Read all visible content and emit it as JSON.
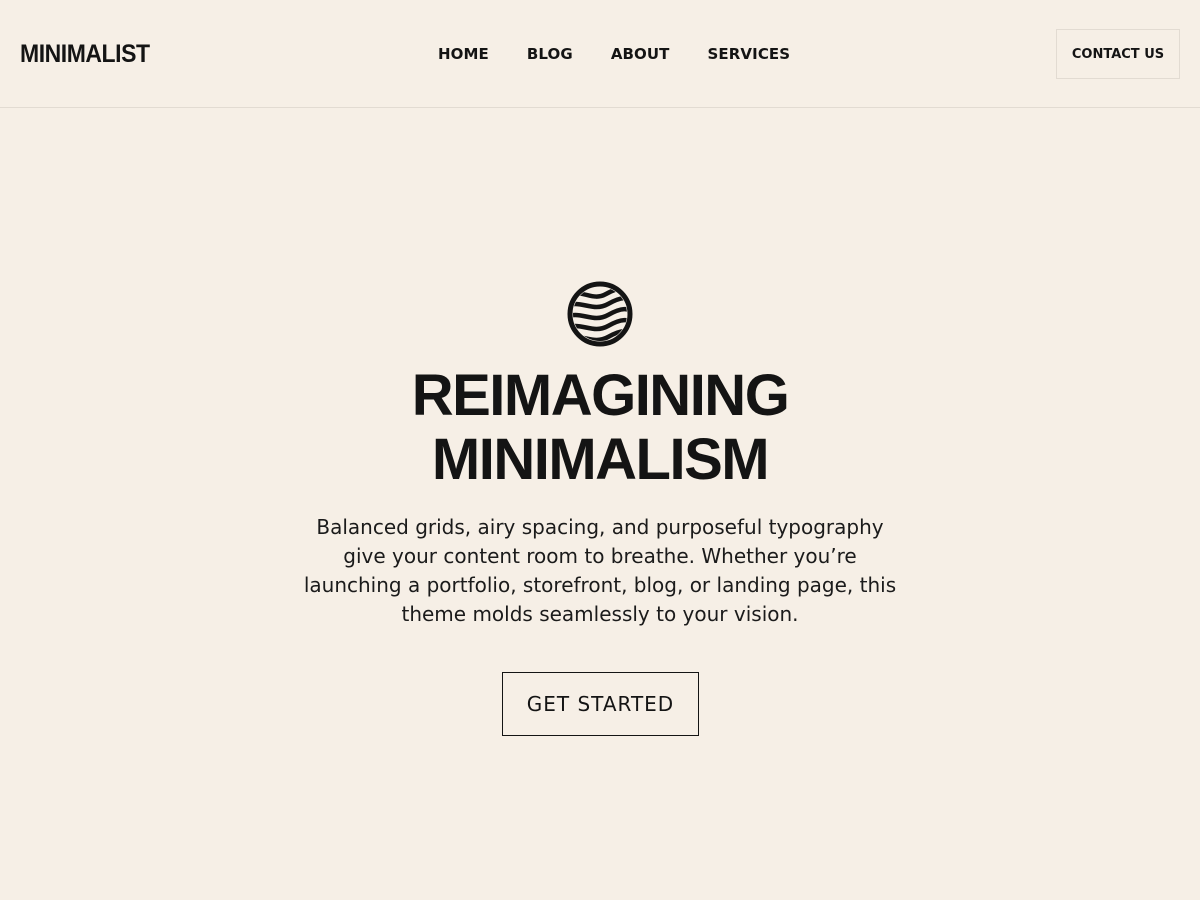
{
  "brand": {
    "logo_text": "MINIMALIST"
  },
  "nav": {
    "items": [
      {
        "label": "HOME"
      },
      {
        "label": "BLOG"
      },
      {
        "label": "ABOUT"
      },
      {
        "label": "SERVICES"
      }
    ]
  },
  "header": {
    "contact_label": "CONTACT US"
  },
  "hero": {
    "icon": "striped-globe-icon",
    "title_line1": "REIMAGINING",
    "title_line2": "MINIMALISM",
    "description": "Balanced grids, airy spacing, and purposeful typography give your content room to breathe. Whether you’re launching a portfolio, storefront, blog, or landing page, this theme molds seamlessly to your vision.",
    "cta_label": "GET STARTED"
  },
  "colors": {
    "background": "#f6efe6",
    "text": "#141414",
    "divider": "#e2dbd2"
  }
}
